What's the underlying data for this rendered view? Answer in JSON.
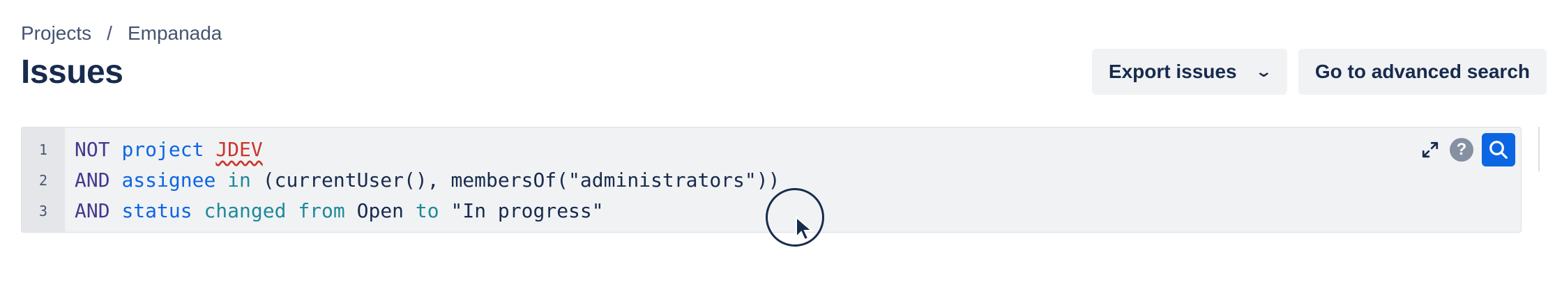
{
  "breadcrumb": {
    "items": [
      "Projects",
      "Empanada"
    ],
    "separator": "/"
  },
  "page_title": "Issues",
  "actions": {
    "export_label": "Export issues",
    "advanced_label": "Go to advanced search"
  },
  "editor": {
    "line_numbers": [
      "1",
      "2",
      "3"
    ],
    "lines": [
      [
        {
          "text": "NOT",
          "kind": "op"
        },
        {
          "text": " ",
          "kind": "plain"
        },
        {
          "text": "project",
          "kind": "field"
        },
        {
          "text": " ",
          "kind": "plain"
        },
        {
          "text": "JDEV",
          "kind": "error"
        }
      ],
      [
        {
          "text": "AND",
          "kind": "op"
        },
        {
          "text": " ",
          "kind": "plain"
        },
        {
          "text": "assignee",
          "kind": "field"
        },
        {
          "text": " ",
          "kind": "plain"
        },
        {
          "text": "in",
          "kind": "in"
        },
        {
          "text": " (currentUser(), membersOf(\"administrators\"))",
          "kind": "plain"
        }
      ],
      [
        {
          "text": "AND",
          "kind": "op"
        },
        {
          "text": " ",
          "kind": "plain"
        },
        {
          "text": "status",
          "kind": "field"
        },
        {
          "text": " ",
          "kind": "plain"
        },
        {
          "text": "changed from",
          "kind": "in"
        },
        {
          "text": " Open ",
          "kind": "plain"
        },
        {
          "text": "to",
          "kind": "in"
        },
        {
          "text": " \"In progress\"",
          "kind": "plain"
        }
      ]
    ]
  },
  "icons": {
    "expand": "expand-icon",
    "help": "help-icon",
    "search": "search-icon",
    "export_chevron": "chevron-down-icon",
    "pointer": "pointer-cursor-icon"
  },
  "colors": {
    "accent": "#0c66e4",
    "keyword_operator": "#44398c",
    "keyword_field": "#0c66e4",
    "keyword_in": "#1d8a9a",
    "error": "#c9372c"
  }
}
